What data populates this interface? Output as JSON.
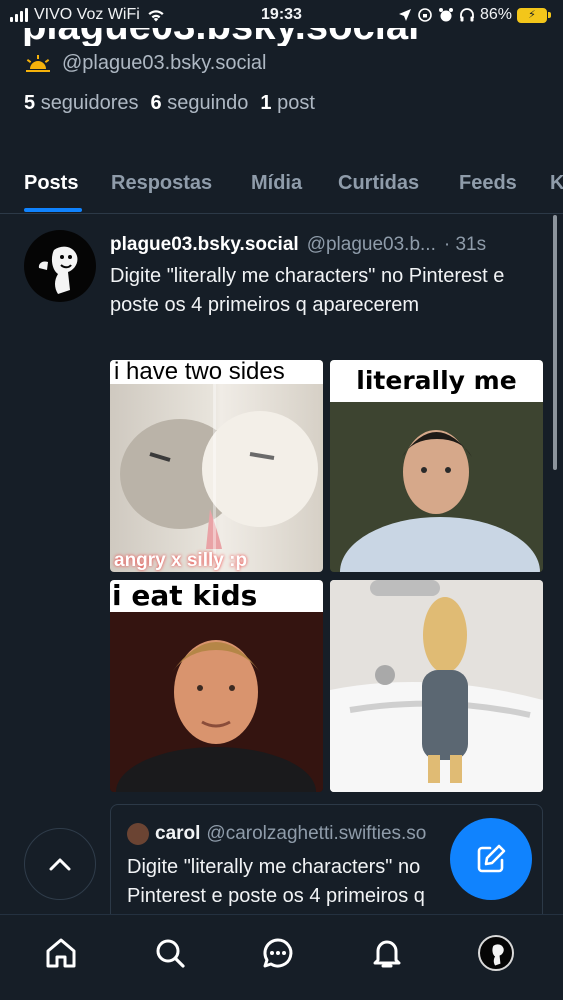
{
  "status_bar": {
    "carrier": "VIVO Voz WiFi",
    "time": "19:33",
    "battery": "86%"
  },
  "profile": {
    "display_name_partial": "plague03.bsky.social",
    "handle": "@plague03.bsky.social",
    "stats": [
      {
        "count": "5",
        "label": "seguidores"
      },
      {
        "count": "6",
        "label": "seguindo"
      },
      {
        "count": "1",
        "label": "post"
      }
    ]
  },
  "tabs": [
    "Posts",
    "Respostas",
    "Mídia",
    "Curtidas",
    "Feeds",
    "K"
  ],
  "post": {
    "author": "plague03.bsky.social",
    "handle": "@plague03.b...",
    "time": "· 31s",
    "text": "Digite \"literally me characters\" no Pinterest e poste os 4 primeiros q aparecerem",
    "images": [
      {
        "caption": "i have two sides",
        "bottom_text": "angry x silly :p"
      },
      {
        "caption": "literally me"
      },
      {
        "caption": "i eat kids"
      },
      {
        "caption": ""
      }
    ]
  },
  "quote": {
    "author": "carol",
    "handle": "@carolzaghetti.swifties.so",
    "text": "Digite \"literally me characters\" no Pinterest e poste os 4 primeiros q"
  },
  "colors": {
    "accent": "#1083fe",
    "background": "#161e27",
    "muted": "#8f9caa"
  },
  "icons": {
    "nav": [
      "home-icon",
      "search-icon",
      "chat-icon",
      "bell-icon",
      "profile-avatar"
    ],
    "floating": [
      "chevron-up-icon",
      "compose-icon"
    ]
  }
}
